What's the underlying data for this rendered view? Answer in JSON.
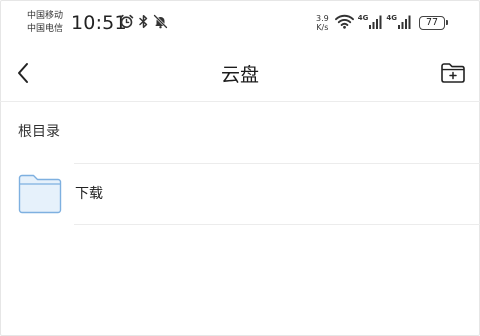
{
  "status_bar": {
    "carrier_1": "中国移动",
    "carrier_2": "中国电信",
    "time": "10:51",
    "speed_value": "3.9",
    "speed_unit": "K/s",
    "signal_1_tag": "4G",
    "signal_2_tag": "4G",
    "battery_level": "77",
    "icons": [
      "alarm-icon",
      "bluetooth-icon",
      "mute-icon",
      "wifi-icon",
      "signal-icon",
      "battery-icon"
    ]
  },
  "header": {
    "title": "云盘",
    "back_icon": "chevron-left-icon",
    "action_icon": "new-folder-icon"
  },
  "breadcrumb": {
    "label": "根目录"
  },
  "files": [
    {
      "name": "下载",
      "type": "folder",
      "icon": "folder-icon"
    }
  ],
  "colors": {
    "folder_fill": "#e6f1fb",
    "folder_stroke": "#7eb0e0",
    "divider": "#ececec"
  }
}
